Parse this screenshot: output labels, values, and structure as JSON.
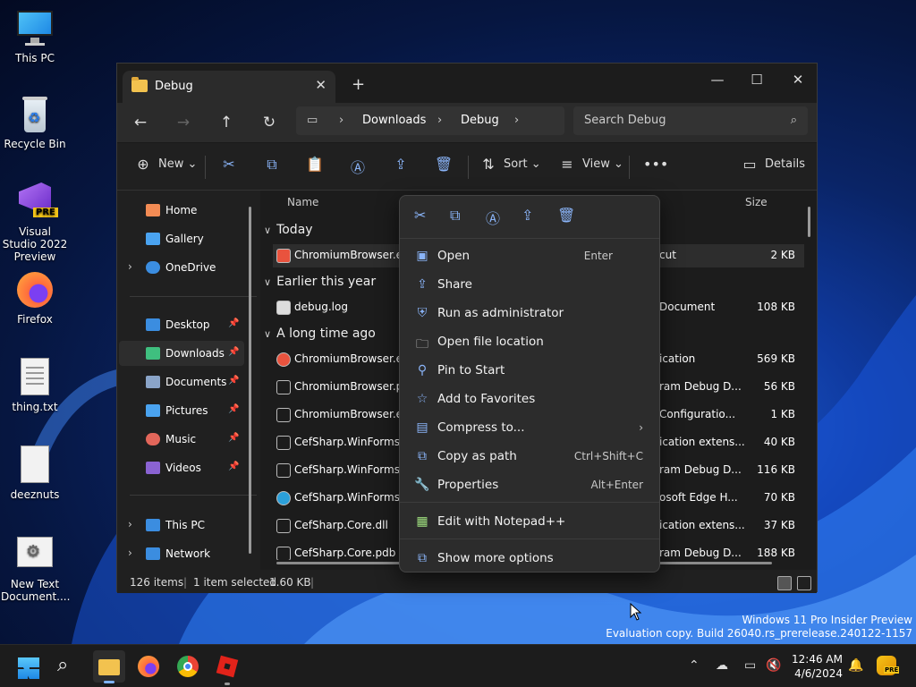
{
  "desktop": {
    "icons": [
      {
        "label": "This PC"
      },
      {
        "label": "Recycle Bin"
      },
      {
        "label": "Visual Studio 2022 Preview",
        "badge": "PRE"
      },
      {
        "label": "Firefox"
      },
      {
        "label": "thing.txt"
      },
      {
        "label": "deeznuts"
      },
      {
        "label": "New Text Document...."
      }
    ],
    "watermark_line1": "Windows 11 Pro Insider Preview",
    "watermark_line2": "Evaluation copy. Build 26040.rs_prerelease.240122-1157"
  },
  "window": {
    "tab_title": "Debug",
    "breadcrumb": [
      "Downloads",
      "Debug"
    ],
    "search_placeholder": "Search Debug",
    "toolbar": {
      "new_label": "New",
      "sort_label": "Sort",
      "view_label": "View",
      "details_label": "Details"
    },
    "sidebar": {
      "items": [
        {
          "label": "Home",
          "color": "#f28b54"
        },
        {
          "label": "Gallery",
          "color": "#4aa3f0"
        },
        {
          "label": "OneDrive",
          "color": "#3b8de0"
        },
        {
          "label": "Desktop",
          "color": "#3b8de0"
        },
        {
          "label": "Downloads",
          "color": "#3fbf7f"
        },
        {
          "label": "Documents",
          "color": "#8aa4c8"
        },
        {
          "label": "Pictures",
          "color": "#4aa3f0"
        },
        {
          "label": "Music",
          "color": "#e2665a"
        },
        {
          "label": "Videos",
          "color": "#8a63d2"
        },
        {
          "label": "This PC",
          "color": "#3b8de0"
        },
        {
          "label": "Network",
          "color": "#3b8de0"
        }
      ]
    },
    "columns": {
      "name": "Name",
      "size": "Size"
    },
    "groups": [
      {
        "label": "Today"
      },
      {
        "label": "Earlier this year"
      },
      {
        "label": "A long time ago"
      }
    ],
    "files": [
      {
        "name": "ChromiumBrowser.exe",
        "type": "cut",
        "size": "2 KB"
      },
      {
        "name": "debug.log",
        "type": "Document",
        "size": "108 KB"
      },
      {
        "name": "ChromiumBrowser.exe",
        "type": "ication",
        "size": "569 KB"
      },
      {
        "name": "ChromiumBrowser.pd",
        "type": "ram Debug D...",
        "size": "56 KB"
      },
      {
        "name": "ChromiumBrowser.exe",
        "type": "Configuratio...",
        "size": "1 KB"
      },
      {
        "name": "CefSharp.WinForms.dl",
        "type": "ication extens...",
        "size": "40 KB"
      },
      {
        "name": "CefSharp.WinForms.pc",
        "type": "ram Debug D...",
        "size": "116 KB"
      },
      {
        "name": "CefSharp.WinForms.xr",
        "type": "osoft Edge H...",
        "size": "70 KB"
      },
      {
        "name": "CefSharp.Core.dll",
        "type": "ication extens...",
        "size": "37 KB"
      },
      {
        "name": "CefSharp.Core.pdb",
        "type": "ram Debug D...",
        "size": "188 KB"
      }
    ],
    "status": {
      "count": "126 items",
      "selected": "1 item selected",
      "size": "1.60 KB"
    }
  },
  "context_menu": {
    "items": [
      {
        "label": "Open",
        "shortcut": "Enter"
      },
      {
        "label": "Share",
        "shortcut": ""
      },
      {
        "label": "Run as administrator",
        "shortcut": ""
      },
      {
        "label": "Open file location",
        "shortcut": ""
      },
      {
        "label": "Pin to Start",
        "shortcut": ""
      },
      {
        "label": "Add to Favorites",
        "shortcut": ""
      },
      {
        "label": "Compress to...",
        "shortcut": ""
      },
      {
        "label": "Copy as path",
        "shortcut": "Ctrl+Shift+C"
      },
      {
        "label": "Properties",
        "shortcut": "Alt+Enter"
      },
      {
        "label": "Edit with Notepad++",
        "shortcut": ""
      },
      {
        "label": "Show more options",
        "shortcut": ""
      }
    ]
  },
  "taskbar": {
    "time": "12:46 AM",
    "date": "4/6/2024",
    "copilot_badge": "PRE"
  }
}
